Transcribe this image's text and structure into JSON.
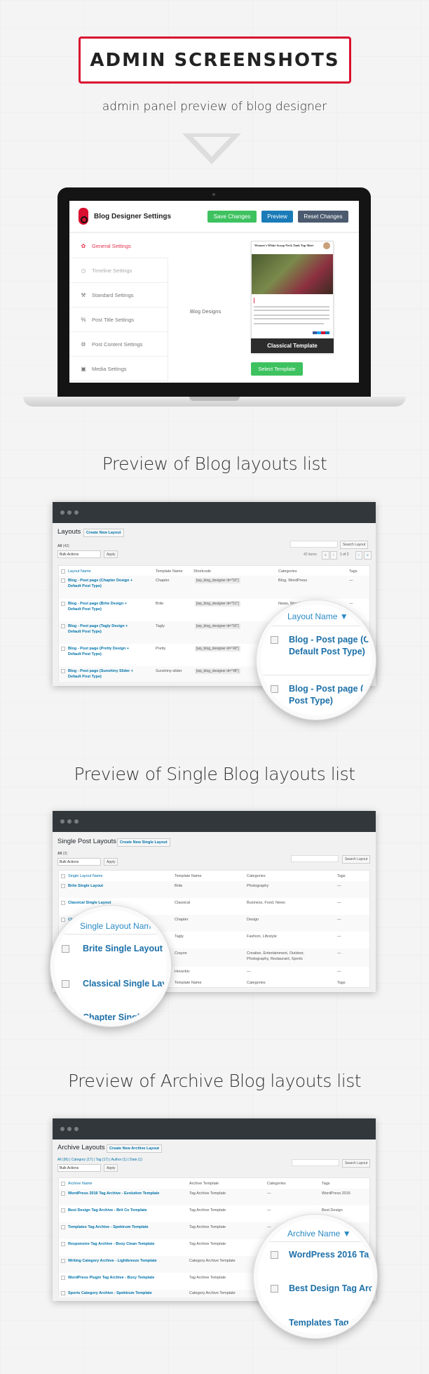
{
  "header": {
    "title": "ADMIN SCREENSHOTS",
    "subtitle": "admin panel preview of blog designer"
  },
  "settings": {
    "title": "Blog Designer Settings",
    "buttons": {
      "save": "Save Changes",
      "preview": "Preview",
      "reset": "Reset Changes"
    },
    "nav": [
      {
        "label": "General Settings",
        "icon": "gear-icon",
        "active": true
      },
      {
        "label": "Timeline Settings",
        "icon": "clock-icon"
      },
      {
        "label": "Standard Settings",
        "icon": "wrench-icon"
      },
      {
        "label": "Post Title Settings",
        "icon": "link-icon"
      },
      {
        "label": "Post Content Settings",
        "icon": "gears-icon"
      },
      {
        "label": "Media Settings",
        "icon": "image-icon"
      }
    ],
    "field_label": "Blog Designs",
    "template": {
      "post_title": "Women's White Scoop Neck Tank Top Shirt",
      "name": "Classical Template",
      "select_label": "Select Template"
    },
    "colors": {
      "save": "#3ec260",
      "preview": "#1a7bb8",
      "reset": "#4b5a6e",
      "accent": "#d9102f"
    }
  },
  "section1": {
    "heading": "Preview of Blog layouts list",
    "page_title": "Layouts",
    "create_label": "Create New Layout",
    "filter": "All",
    "filter_count": "(42)",
    "bulk": "Bulk Actions",
    "apply": "Apply",
    "search_btn": "Search Layout",
    "items_count": "42 items",
    "pagination": {
      "first": "«",
      "prev": "‹",
      "current": "1 of 2",
      "next": "›",
      "last": "»"
    },
    "columns": [
      "Layout Name",
      "Template Name",
      "Shortcode",
      "Categories",
      "Tags"
    ],
    "rows": [
      {
        "name": "Blog - Post page (Chapter Design + Default Post Type)",
        "template": "Chapter",
        "shortcode": "[wp_blog_designer id=\"52\"]",
        "categories": "Blog, WordPress",
        "tags": "—"
      },
      {
        "name": "Blog - Post page (Brite Design + Default Post Type)",
        "template": "Brite",
        "shortcode": "[wp_blog_designer id=\"51\"]",
        "categories": "News, WordPress",
        "tags": "—"
      },
      {
        "name": "Blog - Post page (Tagly Design + Default Post Type)",
        "template": "Tagly",
        "shortcode": "[wp_blog_designer id=\"50\"]",
        "categories": "",
        "tags": ""
      },
      {
        "name": "Blog - Post page (Pretty Design + Default Post Type)",
        "template": "Pretty",
        "shortcode": "[wp_blog_designer id=\"49\"]",
        "categories": "",
        "tags": ""
      },
      {
        "name": "Blog - Post page (Sunshiny Slider + Default Post Type)",
        "template": "Sunshiny-slider",
        "shortcode": "[wp_blog_designer id=\"48\"]",
        "categories": "",
        "tags": ""
      }
    ],
    "magnifier": {
      "header": "Layout Name ▼",
      "rows": [
        "Blog - Post page (C",
        "Default Post Type)",
        "Blog - Post page (",
        "Post Type)"
      ]
    }
  },
  "section2": {
    "heading": "Preview of Single Blog layouts list",
    "page_title": "Single Post Layouts",
    "create_label": "Create New Single Layout",
    "filter": "All",
    "filter_count": "(3)",
    "bulk": "Bulk Actions",
    "apply": "Apply",
    "search_btn": "Search Layout",
    "columns": [
      "Single Layout Name",
      "Template Name",
      "Categories",
      "Tags"
    ],
    "rows": [
      {
        "name": "Brite Single Layout",
        "template": "Brite",
        "categories": "Photography",
        "tags": "—"
      },
      {
        "name": "Classical Single Layout",
        "template": "Classical",
        "categories": "Business, Food, News",
        "tags": "—"
      },
      {
        "name": "Chapter Single Layout",
        "template": "Chapter",
        "categories": "Design",
        "tags": "—"
      },
      {
        "name": "",
        "template": "Tagly",
        "categories": "Fashion, Lifestyle",
        "tags": "—"
      },
      {
        "name": "",
        "template": "Crayon",
        "categories": "Creative, Entertainment, Outdoor, Photography, Restaurant, Sports",
        "tags": "—"
      },
      {
        "name": "",
        "template": "Hoverbic",
        "categories": "—",
        "tags": "—"
      }
    ],
    "footer_columns": [
      "Template Name",
      "Categories",
      "Tags"
    ],
    "magnifier": {
      "header": "Single Layout Nam",
      "rows": [
        "Brite Single Layout",
        "Classical Single Layou",
        "Chapter Single L"
      ]
    }
  },
  "section3": {
    "heading": "Preview of Archive Blog layouts list",
    "page_title": "Archive Layouts",
    "create_label": "Create New Archive Layout",
    "filters": "All (36) | Category (17) | Tag (17) | Author (1) | Date (1)",
    "bulk": "Bulk Actions",
    "apply": "Apply",
    "search_btn": "Search Layout",
    "columns": [
      "Archive Name",
      "Archive Template",
      "Categories",
      "Tags"
    ],
    "rows": [
      {
        "name": "WordPress 2016 Tag Archive - Evolution Template",
        "template": "Tag Archive Template",
        "categories": "—",
        "tags": "WordPress 2016"
      },
      {
        "name": "Best Design Tag Archive - Brit Co Template",
        "template": "Tag Archive Template",
        "categories": "—",
        "tags": "Best Design"
      },
      {
        "name": "Templates Tag Archive - Spektrum Template",
        "template": "Tag Archive Template",
        "categories": "—",
        "tags": ""
      },
      {
        "name": "Responsive Tag Archive - Boxy Clean Template",
        "template": "Tag Archive Template",
        "categories": "",
        "tags": ""
      },
      {
        "name": "Writing Category Archive - Lightbreeze Template",
        "template": "Category Archive Template",
        "categories": "",
        "tags": ""
      },
      {
        "name": "WordPress Plugin Tag Archive - Boxy Template",
        "template": "Tag Archive Template",
        "categories": "",
        "tags": ""
      },
      {
        "name": "Sports Category Archive - Spektrum Template",
        "template": "Category Archive Template",
        "categories": "",
        "tags": ""
      }
    ],
    "magnifier": {
      "header": "Archive Name ▼",
      "rows": [
        "WordPress 2016 Tag",
        "Best Design Tag Archi",
        "Templates Tag A"
      ]
    }
  }
}
